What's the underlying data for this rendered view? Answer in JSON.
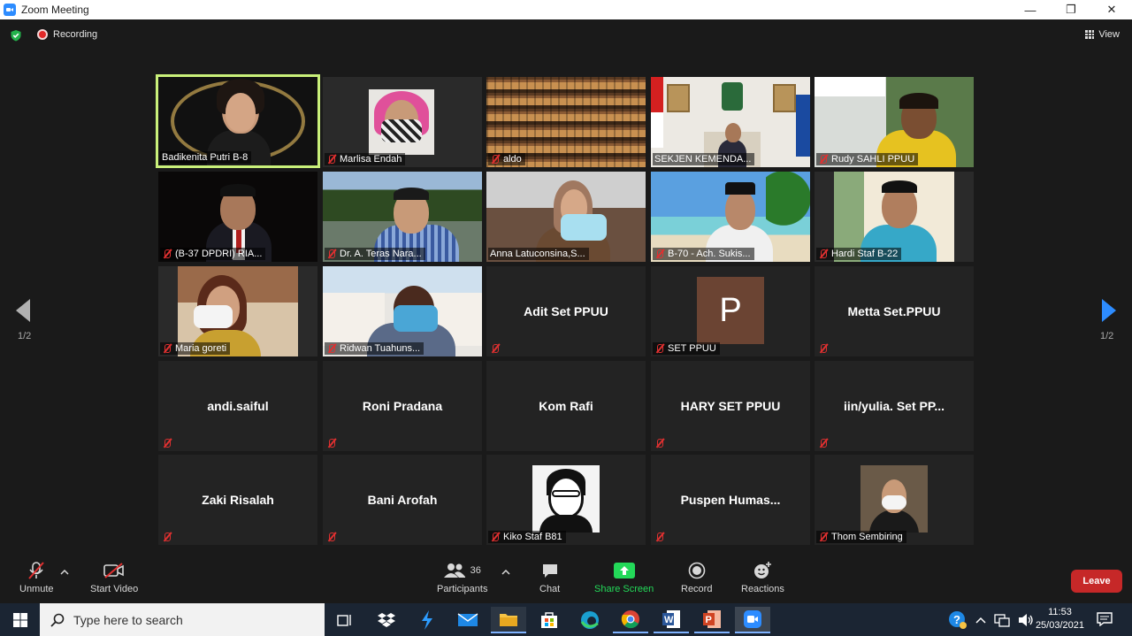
{
  "window": {
    "title": "Zoom Meeting",
    "controls": [
      "—",
      "❐",
      "✕"
    ]
  },
  "topbar": {
    "recording": "Recording",
    "view": "View"
  },
  "pagination": {
    "left": "1/2",
    "right": "1/2"
  },
  "participants": [
    {
      "label": "Badikenita Putri B-8",
      "muted": false,
      "active": true
    },
    {
      "label": "Marlisa Endah",
      "muted": true
    },
    {
      "label": "aldo",
      "muted": true
    },
    {
      "label": "SEKJEN KEMENDA...",
      "muted": false
    },
    {
      "label": "Rudy SAHLI PPUU",
      "muted": true
    },
    {
      "label": "(B-37 DPDRI) RIA...",
      "muted": true
    },
    {
      "label": "Dr. A. Teras Nara...",
      "muted": true
    },
    {
      "label": "Anna Latuconsina,S...",
      "muted": false
    },
    {
      "label": "B-70 - Ach. Sukis...",
      "muted": true
    },
    {
      "label": "Hardi Staf B-22",
      "muted": true
    },
    {
      "label": "Maria goreti",
      "muted": true
    },
    {
      "label": "Ridwan Tuahuns...",
      "muted": true
    },
    {
      "center": "Adit Set PPUU",
      "label": "",
      "muted": true
    },
    {
      "label": "SET PPUU",
      "muted": true,
      "avatar": "P"
    },
    {
      "center": "Metta Set.PPUU",
      "label": "",
      "muted": true
    },
    {
      "center": "andi.saiful",
      "label": "",
      "muted": true
    },
    {
      "center": "Roni Pradana",
      "label": "",
      "muted": true
    },
    {
      "center": "Kom Rafi",
      "label": "",
      "muted": false
    },
    {
      "center": "HARY SET PPUU",
      "label": "",
      "muted": true
    },
    {
      "center": "iin/yulia.  Set  PP...",
      "label": "",
      "muted": true
    },
    {
      "center": "Zaki Risalah",
      "label": "",
      "muted": true
    },
    {
      "center": "Bani Arofah",
      "label": "",
      "muted": true
    },
    {
      "label": "Kiko Staf B81",
      "muted": true
    },
    {
      "center": "Puspen  Humas...",
      "label": "",
      "muted": true
    },
    {
      "label": "Thom Sembiring",
      "muted": true
    }
  ],
  "toolbar": {
    "unmute": "Unmute",
    "start_video": "Start Video",
    "participants_label": "Participants",
    "participants_count": "36",
    "chat": "Chat",
    "share_screen": "Share Screen",
    "record": "Record",
    "reactions": "Reactions",
    "leave": "Leave",
    "share_color": "#23d959"
  },
  "taskbar": {
    "search_placeholder": "Type here to search",
    "time": "11:53",
    "date": "25/03/2021"
  }
}
